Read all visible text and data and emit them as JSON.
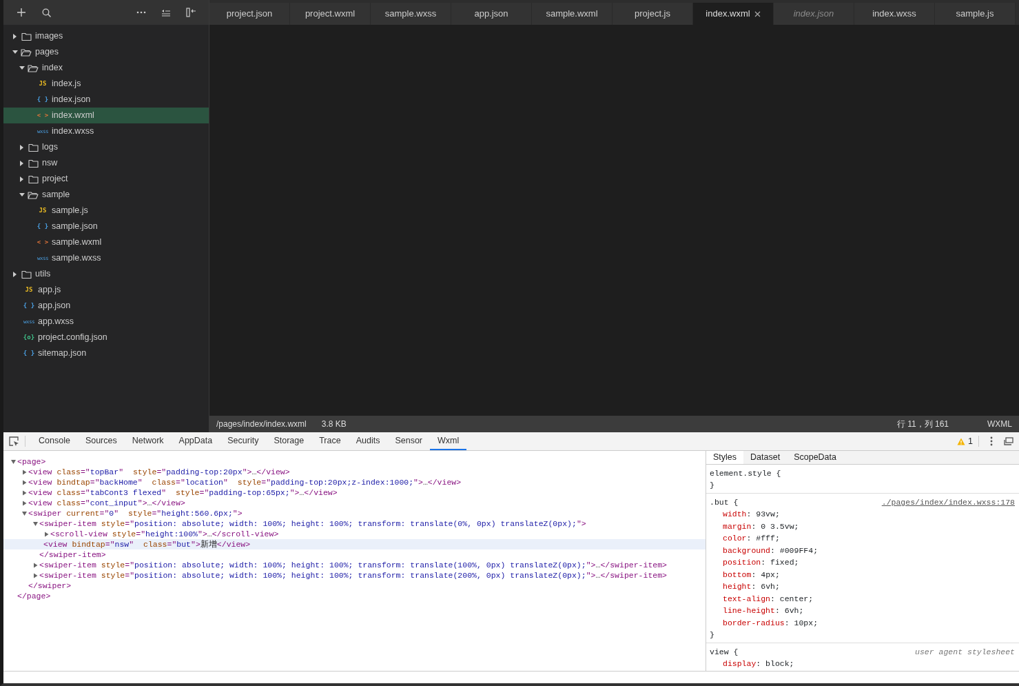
{
  "file_tree": [
    {
      "kind": "folder",
      "name": "images",
      "expanded": false,
      "selected": false
    },
    {
      "kind": "folder",
      "name": "pages",
      "expanded": true,
      "selected": false,
      "children": [
        {
          "kind": "folder",
          "name": "index",
          "expanded": true,
          "selected": false,
          "children": [
            {
              "kind": "js",
              "badge": "JS",
              "name": "index.js",
              "selected": false
            },
            {
              "kind": "json",
              "badge": "{ }",
              "name": "index.json",
              "selected": false
            },
            {
              "kind": "wxml",
              "badge": "< >",
              "name": "index.wxml",
              "selected": true
            },
            {
              "kind": "wxss",
              "badge": "wxss",
              "name": "index.wxss",
              "selected": false
            }
          ]
        },
        {
          "kind": "folder",
          "name": "logs",
          "expanded": false,
          "selected": false
        },
        {
          "kind": "folder",
          "name": "nsw",
          "expanded": false,
          "selected": false
        },
        {
          "kind": "folder",
          "name": "project",
          "expanded": false,
          "selected": false
        },
        {
          "kind": "folder",
          "name": "sample",
          "expanded": true,
          "selected": false,
          "children": [
            {
              "kind": "js",
              "badge": "JS",
              "name": "sample.js",
              "selected": false
            },
            {
              "kind": "json",
              "badge": "{ }",
              "name": "sample.json",
              "selected": false
            },
            {
              "kind": "wxml",
              "badge": "< >",
              "name": "sample.wxml",
              "selected": false
            },
            {
              "kind": "wxss",
              "badge": "wxss",
              "name": "sample.wxss",
              "selected": false
            }
          ]
        }
      ]
    },
    {
      "kind": "folder",
      "name": "utils",
      "expanded": false,
      "selected": false
    },
    {
      "kind": "js",
      "badge": "JS",
      "name": "app.js",
      "selected": false
    },
    {
      "kind": "json",
      "badge": "{ }",
      "name": "app.json",
      "selected": false
    },
    {
      "kind": "wxss",
      "badge": "wxss",
      "name": "app.wxss",
      "selected": false
    },
    {
      "kind": "config",
      "badge": "{o}",
      "name": "project.config.json",
      "selected": false
    },
    {
      "kind": "json",
      "badge": "{ }",
      "name": "sitemap.json",
      "selected": false
    }
  ],
  "editor_tabs": [
    {
      "label": "project.json",
      "selected": false,
      "preview": false
    },
    {
      "label": "project.wxml",
      "selected": false,
      "preview": false
    },
    {
      "label": "sample.wxss",
      "selected": false,
      "preview": false
    },
    {
      "label": "app.json",
      "selected": false,
      "preview": false
    },
    {
      "label": "sample.wxml",
      "selected": false,
      "preview": false
    },
    {
      "label": "project.js",
      "selected": false,
      "preview": false
    },
    {
      "label": "index.wxml",
      "selected": true,
      "preview": false
    },
    {
      "label": "index.json",
      "selected": false,
      "preview": true
    },
    {
      "label": "index.wxss",
      "selected": false,
      "preview": false
    },
    {
      "label": "sample.js",
      "selected": false,
      "preview": false
    }
  ],
  "status_bar": {
    "path": "/pages/index/index.wxml",
    "size": "3.8 KB",
    "position": "行 11，列 161",
    "language": "WXML"
  },
  "devtools": {
    "tabs": [
      {
        "label": "Console",
        "selected": false
      },
      {
        "label": "Sources",
        "selected": false
      },
      {
        "label": "Network",
        "selected": false
      },
      {
        "label": "AppData",
        "selected": false
      },
      {
        "label": "Security",
        "selected": false
      },
      {
        "label": "Storage",
        "selected": false
      },
      {
        "label": "Trace",
        "selected": false
      },
      {
        "label": "Audits",
        "selected": false
      },
      {
        "label": "Sensor",
        "selected": false
      },
      {
        "label": "Wxml",
        "selected": true
      }
    ],
    "warning_count": "1",
    "wxml_tree": [
      {
        "expanded": true,
        "selected": false,
        "parts": [
          {
            "kind": "tag",
            "text": "<page>"
          }
        ],
        "children": [
          {
            "expanded": false,
            "selected": false,
            "parts": [
              {
                "kind": "tag",
                "text": "<view"
              },
              {
                "kind": "attr",
                "text": " class"
              },
              {
                "kind": "tag",
                "text": "=\""
              },
              {
                "kind": "value",
                "text": "topBar"
              },
              {
                "kind": "tag",
                "text": "\""
              },
              {
                "kind": "attr",
                "text": "  style"
              },
              {
                "kind": "tag",
                "text": "=\""
              },
              {
                "kind": "value",
                "text": "padding-top:20px"
              },
              {
                "kind": "tag",
                "text": "\">"
              },
              {
                "kind": "ellipsis",
                "text": "…"
              },
              {
                "kind": "tag",
                "text": "</view>"
              }
            ]
          },
          {
            "expanded": false,
            "selected": false,
            "parts": [
              {
                "kind": "tag",
                "text": "<view"
              },
              {
                "kind": "attr",
                "text": " bindtap"
              },
              {
                "kind": "tag",
                "text": "=\""
              },
              {
                "kind": "value",
                "text": "backHome"
              },
              {
                "kind": "tag",
                "text": "\""
              },
              {
                "kind": "attr",
                "text": "  class"
              },
              {
                "kind": "tag",
                "text": "=\""
              },
              {
                "kind": "value",
                "text": "location"
              },
              {
                "kind": "tag",
                "text": "\""
              },
              {
                "kind": "attr",
                "text": "  style"
              },
              {
                "kind": "tag",
                "text": "=\""
              },
              {
                "kind": "value",
                "text": "padding-top:20px;z-index:1000;"
              },
              {
                "kind": "tag",
                "text": "\">"
              },
              {
                "kind": "ellipsis",
                "text": "…"
              },
              {
                "kind": "tag",
                "text": "</view>"
              }
            ]
          },
          {
            "expanded": false,
            "selected": false,
            "parts": [
              {
                "kind": "tag",
                "text": "<view"
              },
              {
                "kind": "attr",
                "text": " class"
              },
              {
                "kind": "tag",
                "text": "=\""
              },
              {
                "kind": "value",
                "text": "tabCont3 flexed"
              },
              {
                "kind": "tag",
                "text": "\""
              },
              {
                "kind": "attr",
                "text": "  style"
              },
              {
                "kind": "tag",
                "text": "=\""
              },
              {
                "kind": "value",
                "text": "padding-top:65px;"
              },
              {
                "kind": "tag",
                "text": "\">"
              },
              {
                "kind": "ellipsis",
                "text": "…"
              },
              {
                "kind": "tag",
                "text": "</view>"
              }
            ]
          },
          {
            "expanded": false,
            "selected": false,
            "parts": [
              {
                "kind": "tag",
                "text": "<view"
              },
              {
                "kind": "attr",
                "text": " class"
              },
              {
                "kind": "tag",
                "text": "=\""
              },
              {
                "kind": "value",
                "text": "cont_input"
              },
              {
                "kind": "tag",
                "text": "\">"
              },
              {
                "kind": "ellipsis",
                "text": "…"
              },
              {
                "kind": "tag",
                "text": "</view>"
              }
            ]
          },
          {
            "expanded": true,
            "selected": false,
            "parts": [
              {
                "kind": "tag",
                "text": "<swiper"
              },
              {
                "kind": "attr",
                "text": " current"
              },
              {
                "kind": "tag",
                "text": "=\""
              },
              {
                "kind": "value",
                "text": "0"
              },
              {
                "kind": "tag",
                "text": "\""
              },
              {
                "kind": "attr",
                "text": "  style"
              },
              {
                "kind": "tag",
                "text": "=\""
              },
              {
                "kind": "value",
                "text": "height:560.6px;"
              },
              {
                "kind": "tag",
                "text": "\">"
              }
            ],
            "children": [
              {
                "expanded": true,
                "selected": false,
                "parts": [
                  {
                    "kind": "tag",
                    "text": "<swiper-item"
                  },
                  {
                    "kind": "attr",
                    "text": " style"
                  },
                  {
                    "kind": "tag",
                    "text": "=\""
                  },
                  {
                    "kind": "value",
                    "text": "position: absolute; width: 100%; height: 100%; transform: translate(0%, 0px) translateZ(0px);"
                  },
                  {
                    "kind": "tag",
                    "text": "\">"
                  }
                ],
                "children": [
                  {
                    "expanded": false,
                    "selected": false,
                    "parts": [
                      {
                        "kind": "tag",
                        "text": "<scroll-view"
                      },
                      {
                        "kind": "attr",
                        "text": " style"
                      },
                      {
                        "kind": "tag",
                        "text": "=\""
                      },
                      {
                        "kind": "value",
                        "text": "height:100%"
                      },
                      {
                        "kind": "tag",
                        "text": "\">"
                      },
                      {
                        "kind": "ellipsis",
                        "text": "…"
                      },
                      {
                        "kind": "tag",
                        "text": "</scroll-view>"
                      }
                    ]
                  },
                  {
                    "selected": true,
                    "parts": [
                      {
                        "kind": "tag",
                        "text": "<view"
                      },
                      {
                        "kind": "attr",
                        "text": " bindtap"
                      },
                      {
                        "kind": "tag",
                        "text": "=\""
                      },
                      {
                        "kind": "value",
                        "text": "nsw"
                      },
                      {
                        "kind": "tag",
                        "text": "\""
                      },
                      {
                        "kind": "attr",
                        "text": "  class"
                      },
                      {
                        "kind": "tag",
                        "text": "=\""
                      },
                      {
                        "kind": "value",
                        "text": "but"
                      },
                      {
                        "kind": "tag",
                        "text": "\">"
                      },
                      {
                        "kind": "text",
                        "text": "新增"
                      },
                      {
                        "kind": "tag",
                        "text": "</view>"
                      }
                    ]
                  }
                ],
                "closing": [
                  {
                    "kind": "tag",
                    "text": "</swiper-item>"
                  }
                ]
              },
              {
                "expanded": false,
                "selected": false,
                "parts": [
                  {
                    "kind": "tag",
                    "text": "<swiper-item"
                  },
                  {
                    "kind": "attr",
                    "text": " style"
                  },
                  {
                    "kind": "tag",
                    "text": "=\""
                  },
                  {
                    "kind": "value",
                    "text": "position: absolute; width: 100%; height: 100%; transform: translate(100%, 0px) translateZ(0px);"
                  },
                  {
                    "kind": "tag",
                    "text": "\">"
                  },
                  {
                    "kind": "ellipsis",
                    "text": "…"
                  },
                  {
                    "kind": "tag",
                    "text": "</swiper-item>"
                  }
                ]
              },
              {
                "expanded": false,
                "selected": false,
                "parts": [
                  {
                    "kind": "tag",
                    "text": "<swiper-item"
                  },
                  {
                    "kind": "attr",
                    "text": " style"
                  },
                  {
                    "kind": "tag",
                    "text": "=\""
                  },
                  {
                    "kind": "value",
                    "text": "position: absolute; width: 100%; height: 100%; transform: translate(200%, 0px) translateZ(0px);"
                  },
                  {
                    "kind": "tag",
                    "text": "\">"
                  },
                  {
                    "kind": "ellipsis",
                    "text": "…"
                  },
                  {
                    "kind": "tag",
                    "text": "</swiper-item>"
                  }
                ]
              }
            ],
            "closing": [
              {
                "kind": "tag",
                "text": "</swiper>"
              }
            ]
          }
        ],
        "closing": [
          {
            "kind": "tag",
            "text": "</page>"
          }
        ]
      }
    ],
    "side_tabs": [
      {
        "label": "Styles",
        "selected": true
      },
      {
        "label": "Dataset",
        "selected": false
      },
      {
        "label": "ScopeData",
        "selected": false
      }
    ],
    "style_rules": [
      {
        "selector": "element.style {",
        "close": "}"
      },
      {
        "selector": ".but {",
        "agent": false,
        "source": "./pages/index/index.wxss:178",
        "properties": [
          {
            "name": "width",
            "value": ": 93vw;"
          },
          {
            "name": "margin",
            "value": ": 0 3.5vw;"
          },
          {
            "name": "color",
            "value": ": #fff;"
          },
          {
            "name": "background",
            "value": ": #009FF4;"
          },
          {
            "name": "position",
            "value": ": fixed;"
          },
          {
            "name": "bottom",
            "value": ": 4px;"
          },
          {
            "name": "height",
            "value": ": 6vh;"
          },
          {
            "name": "text-align",
            "value": ": center;"
          },
          {
            "name": "line-height",
            "value": ": 6vh;"
          },
          {
            "name": "border-radius",
            "value": ": 10px;"
          }
        ],
        "close": "}"
      },
      {
        "selector": "view {",
        "agent": true,
        "source": "user agent stylesheet",
        "properties": [
          {
            "name": "display",
            "value": ": block;"
          }
        ]
      }
    ]
  }
}
